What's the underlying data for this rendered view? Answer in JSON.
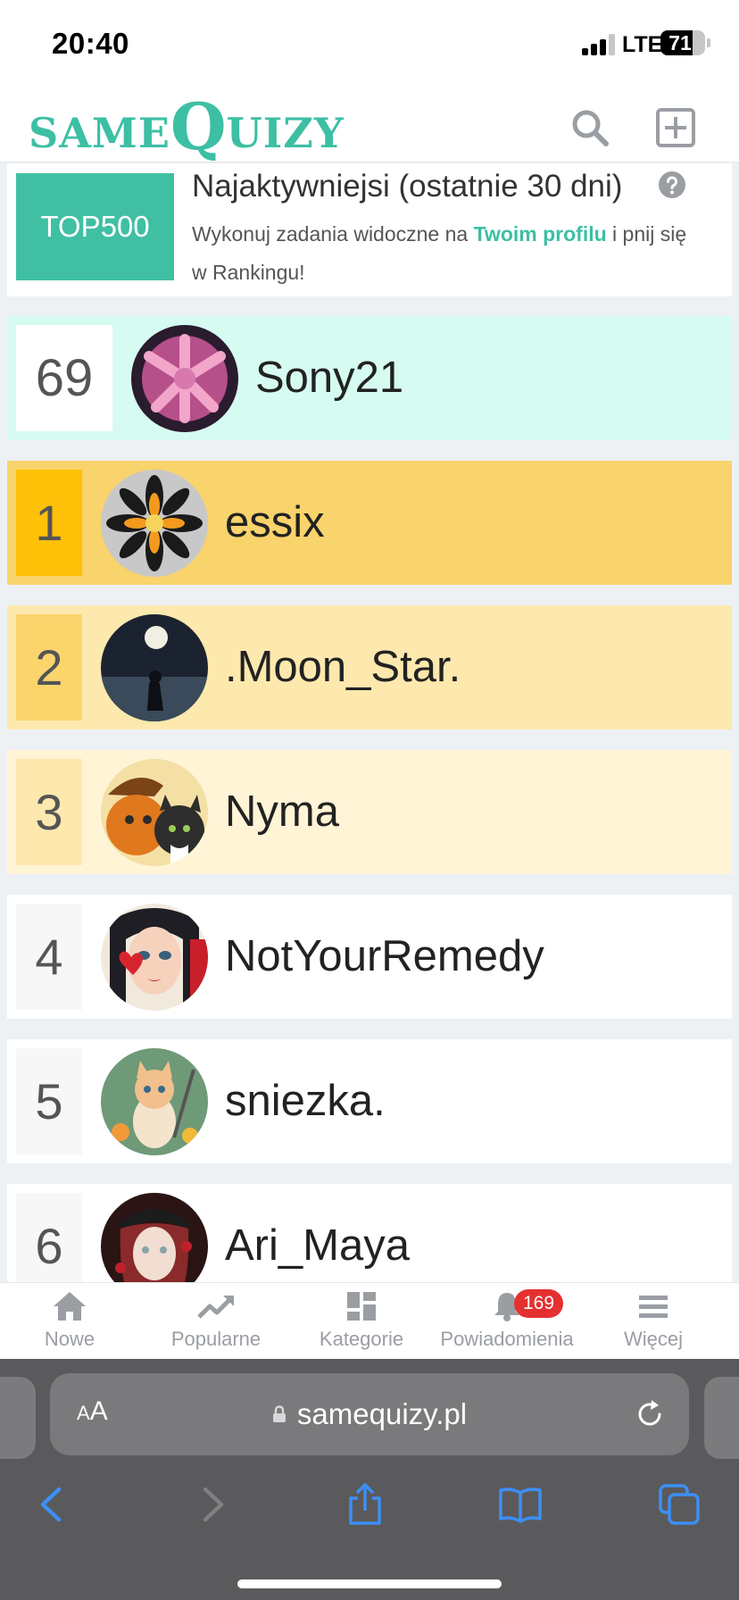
{
  "status_bar": {
    "time": "20:40",
    "network": "LTE",
    "battery": "71",
    "battery_level": 0.71,
    "signal_bars": 3
  },
  "header": {
    "logo_small_1": "SAME",
    "logo_big_q": "Q",
    "logo_small_2": "UIZY",
    "search_icon": "search-icon",
    "add_icon": "add-square-icon"
  },
  "info": {
    "badge": "TOP500",
    "title": "Najaktywniejsi (ostatnie 30 dni)",
    "text_before": "Wykonuj zadania widoczne na ",
    "link": "Twoim profilu",
    "text_after": " i pnij się w Rankingu!",
    "help_icon": "question-circle-icon"
  },
  "current_user": {
    "rank": "69",
    "name": "Sony21"
  },
  "ranking": [
    {
      "rank": "1",
      "name": "essix"
    },
    {
      "rank": "2",
      "name": ".Moon_Star."
    },
    {
      "rank": "3",
      "name": "Nyma"
    },
    {
      "rank": "4",
      "name": "NotYourRemedy"
    },
    {
      "rank": "5",
      "name": "sniezka."
    },
    {
      "rank": "6",
      "name": "Ari_Maya"
    }
  ],
  "colors": {
    "brand": "#3dbfa4",
    "current_row": "#d6fbf1",
    "gold_row": "#f9d36b",
    "gold_box": "#ffc107",
    "silver_row": "#fde8ad",
    "silver_box": "#fbd56c",
    "bronze_row": "#fff4d6",
    "bronze_box": "#fde8ad",
    "badge_red": "#e53030"
  },
  "tabbar": {
    "items": [
      {
        "label": "Nowe",
        "icon": "home-icon"
      },
      {
        "label": "Popularne",
        "icon": "trending-up-icon"
      },
      {
        "label": "Kategorie",
        "icon": "dashboard-icon"
      },
      {
        "label": "Powiadomienia",
        "icon": "bell-icon"
      },
      {
        "label": "Więcej",
        "icon": "menu-icon"
      }
    ],
    "notifications_count": "169"
  },
  "browser": {
    "text_size": "AA",
    "url": "samequizy.pl",
    "lock_icon": "lock-icon",
    "reload_icon": "reload-icon",
    "back_icon": "back-chevron-icon",
    "forward_icon": "forward-chevron-icon",
    "share_icon": "share-icon",
    "bookmarks_icon": "book-icon",
    "tabs_icon": "tabs-icon"
  }
}
